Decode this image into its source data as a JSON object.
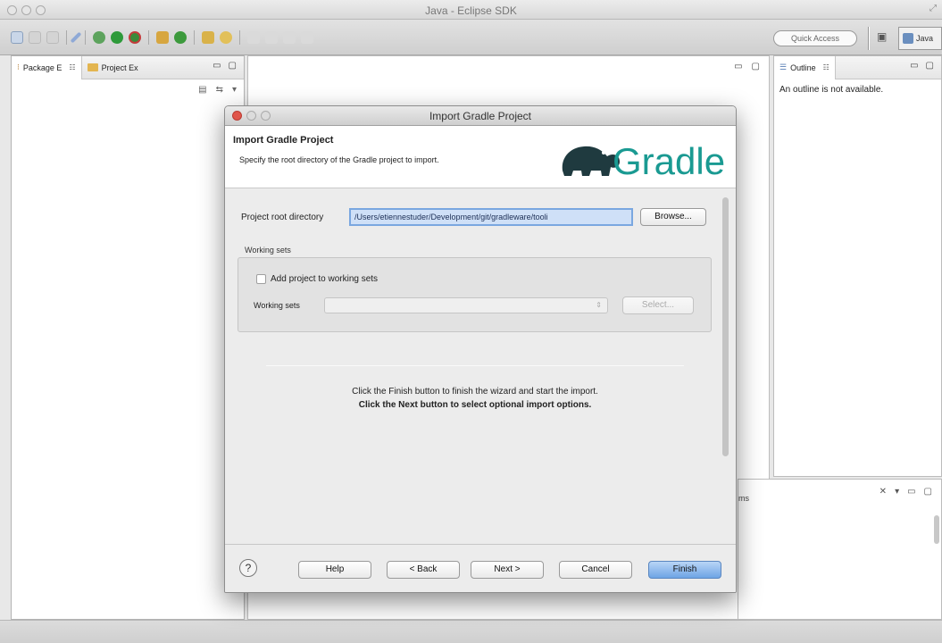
{
  "window": {
    "title": "Java - Eclipse SDK"
  },
  "toolbar": {
    "quick_access": "Quick Access",
    "perspective": "Java"
  },
  "left_panel": {
    "tabs": [
      {
        "label": "Package E",
        "mini": "☷"
      },
      {
        "label": "Project Ex"
      }
    ]
  },
  "outline": {
    "tab_label": "Outline",
    "tab_mini": "☷",
    "message": "An outline is not available."
  },
  "bottom_panel": {
    "tab_fragment": "ms"
  },
  "dialog": {
    "window_title": "Import Gradle Project",
    "header_title": "Import Gradle Project",
    "header_desc": "Specify the root directory of the Gradle project to import.",
    "logo_text": "Gradle",
    "root_label": "Project root directory",
    "root_value": "/Users/etiennestuder/Development/git/gradleware/tooli",
    "browse_label": "Browse...",
    "working_sets_group": "Working sets",
    "add_to_ws_label": "Add project to working sets",
    "add_to_ws_checked": false,
    "ws_select_label": "Working sets",
    "ws_select_value": "",
    "select_button": "Select...",
    "message_finish": "Click the Finish button to finish the wizard and start the import.",
    "message_next": "Click the Next button to select optional import options.",
    "help_symbol": "?",
    "buttons": {
      "help": "Help",
      "back": "< Back",
      "next": "Next >",
      "cancel": "Cancel",
      "finish": "Finish"
    }
  },
  "colors": {
    "accent": "#6ea4e5",
    "gradle_green": "#1a9a92",
    "logo_dark": "#1f3a3f"
  }
}
